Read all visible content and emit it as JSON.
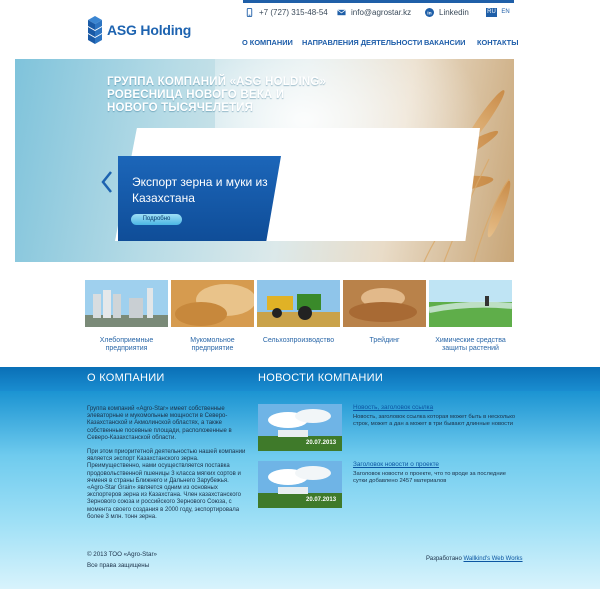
{
  "header": {
    "logo_text": "ASG Holding",
    "phone": "+7 (727) 315-48-54",
    "email": "info@agrostar.kz",
    "linkedin": "Linkedin",
    "languages": [
      "RU",
      "EN"
    ],
    "active_language": "RU"
  },
  "nav": [
    "О КОМПАНИИ",
    "НАПРАВЛЕНИЯ ДЕЯТЕЛЬНОСТИ",
    "ВАКАНСИИ",
    "КОНТАКТЫ"
  ],
  "hero": {
    "title": "ГРУППА КОМПАНИЙ «ASG HOLDING» РОВЕСНИЦА НОВОГО ВЕКА И НОВОГО ТЫСЯЧЕЛЕТИЯ",
    "subtitle": "Экспорт зерна и муки из Казахстана",
    "button": "Подробно"
  },
  "directions": [
    "Хлебоприемные предприятия",
    "Мукомольное предприятие",
    "Сельхозпроизводство",
    "Трейдинг",
    "Химические средства защиты растений"
  ],
  "about": {
    "heading": "О КОМПАНИИ",
    "p1": "Группа компаний «Agro-Star» имеет собственные элеваторные и мукомольные мощности в Северо-Казахстанской и Акмолинской областях, а также собственные посевные площади, расположенные в Северо-Казахстанской области.",
    "p2": "При этом приоритетной деятельностью нашей компании является экспорт Казахстанского зерна. Преимущественно, нами осуществляется поставка продовольственной пшеницы 3 класса мягких сортов и ячменя в страны Ближнего и Дальнего Зарубежья. «Agro-Star Grain» является одним из основных экспортеров зерна из Казахстана. Член казахстанского Зернового союза и российского Зернового Союза, с момента своего создания в 2000 году, экспортировала более 3 млн. тонн зерна."
  },
  "news": {
    "heading": "НОВОСТИ КОМПАНИИ",
    "items": [
      {
        "date": "20.07.2013",
        "title": "Новость, заголовок ссылка",
        "text": "Новость, заголовок ссылка которая может быть в несколько строк, может а дан а может в три бывают длинные новости"
      },
      {
        "date": "20.07.2013",
        "title": "Заголовок новости о проекте",
        "text": "Заголовок новости о проекте, что то вроде за последние сутки добавлено 2457 материалов"
      }
    ]
  },
  "footer": {
    "copyright": "© 2013 ТОО «Agro-Star»",
    "rights": "Все права защищены",
    "dev_label": "Разработано",
    "dev_link": "Wallkind's Web Works"
  },
  "colors": {
    "brand": "#1d63b0",
    "band_top": "#0a6fb6",
    "band_bottom": "#d8f3fc"
  }
}
